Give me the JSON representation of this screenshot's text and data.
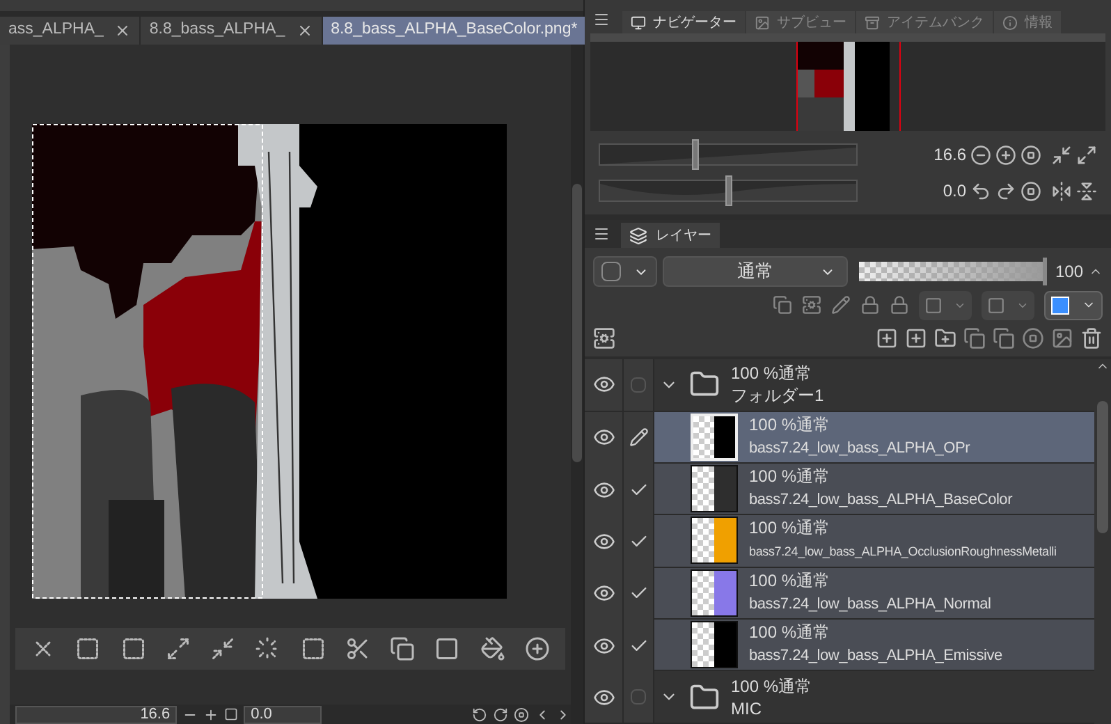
{
  "doc_tabs": [
    {
      "label": "ass_ALPHA_",
      "selected": false,
      "modified": false
    },
    {
      "label": "8.8_bass_ALPHA_",
      "selected": false,
      "modified": false
    },
    {
      "label": "8.8_bass_ALPHA_BaseColor.png*",
      "selected": true,
      "modified": true
    }
  ],
  "navigator": {
    "tabs": [
      {
        "label": "ナビゲーター",
        "selected": true
      },
      {
        "label": "サブビュー",
        "selected": false
      },
      {
        "label": "アイテムバンク",
        "selected": false
      },
      {
        "label": "情報",
        "selected": false
      }
    ],
    "zoom": {
      "reading": "16.6",
      "level": 0.37
    },
    "rotation": {
      "reading": "0.0",
      "level": 0.5
    }
  },
  "layer_panel": {
    "tab": "レイヤー",
    "blend_mode": "通常",
    "opacity": {
      "reading": "100",
      "level": 1
    },
    "layers": [
      {
        "kind": "folder",
        "blend": "100 %通常",
        "name": "フォルダー1",
        "visible": true,
        "checked": false,
        "selected": false,
        "expanded": true,
        "children": [
          {
            "kind": "layer",
            "blend": "100 %通常",
            "name": "bass7.24_low_bass_ALPHA_OPr",
            "visible": true,
            "selected": true,
            "color": "#000000"
          },
          {
            "kind": "layer",
            "blend": "100 %通常",
            "name": "bass7.24_low_bass_ALPHA_BaseColor",
            "visible": true,
            "checked": true,
            "selected": false,
            "color": "#2e2e2e"
          },
          {
            "kind": "layer",
            "blend": "100 %通常",
            "name": "bass7.24_low_bass_ALPHA_OcclusionRoughnessMetalli",
            "visible": true,
            "checked": true,
            "selected": false,
            "color": "#f0a000"
          },
          {
            "kind": "layer",
            "blend": "100 %通常",
            "name": "bass7.24_low_bass_ALPHA_Normal",
            "visible": true,
            "checked": true,
            "selected": false,
            "color": "#8878e8"
          },
          {
            "kind": "layer",
            "blend": "100 %通常",
            "name": "bass7.24_low_bass_ALPHA_Emissive",
            "visible": true,
            "checked": true,
            "selected": false,
            "color": "#000000"
          }
        ]
      },
      {
        "kind": "folder",
        "blend": "100 %通常",
        "name": "MIC",
        "visible": true,
        "checked": false,
        "selected": false,
        "expanded": true
      }
    ]
  },
  "status_bar": {
    "zoom": "16.6",
    "angle": "0.0"
  }
}
